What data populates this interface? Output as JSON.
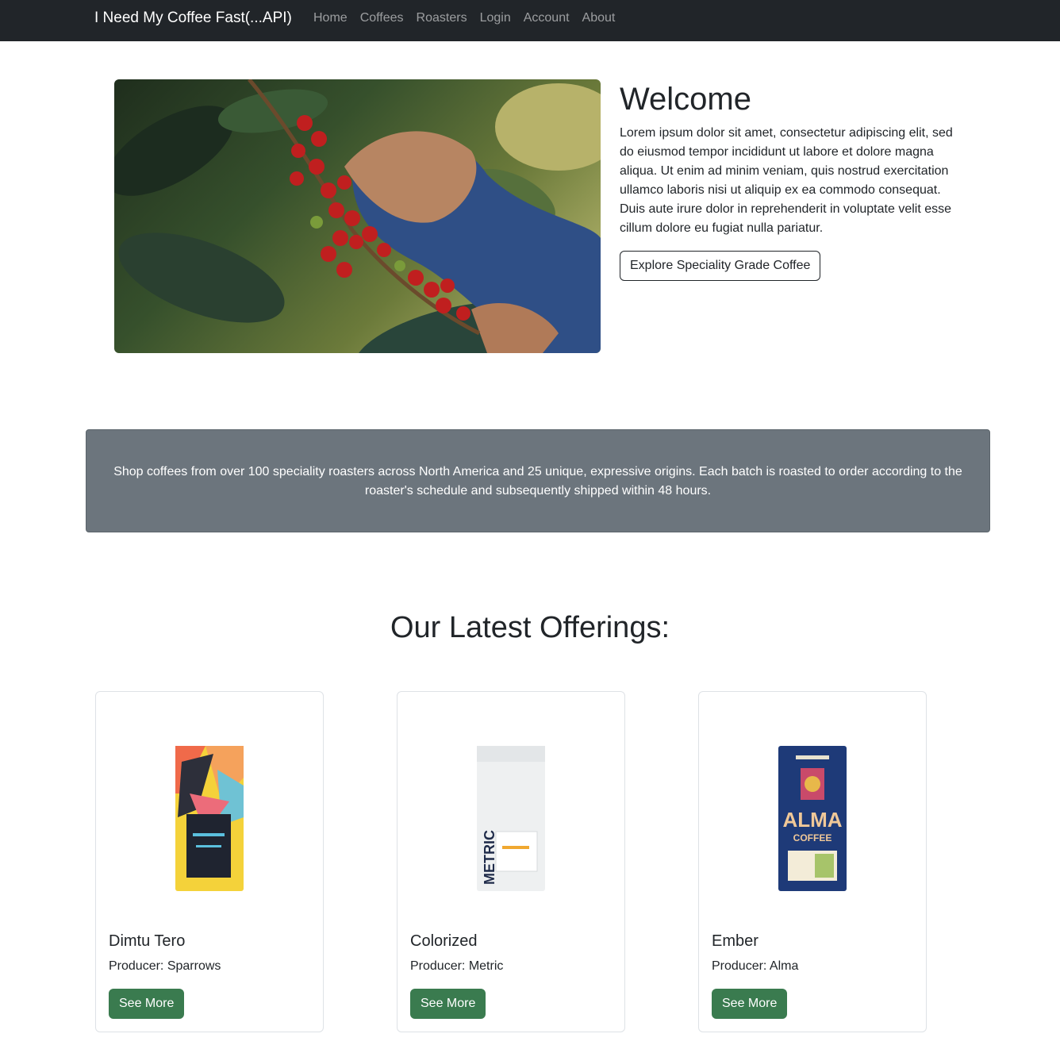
{
  "navbar": {
    "brand": "I Need My Coffee Fast(...API)",
    "links": [
      "Home",
      "Coffees",
      "Roasters",
      "Login",
      "Account",
      "About"
    ]
  },
  "hero": {
    "title": "Welcome",
    "text": "Lorem ipsum dolor sit amet, consectetur adipiscing elit, sed do eiusmod tempor incididunt ut labore et dolore magna aliqua. Ut enim ad minim veniam, quis nostrud exercitation ullamco laboris nisi ut aliquip ex ea commodo consequat. Duis aute irure dolor in reprehenderit in voluptate velit esse cillum dolore eu fugiat nulla pariatur.",
    "button_label": "Explore Speciality Grade Coffee"
  },
  "banner": {
    "text": "Shop coffees from over 100 speciality roasters across North America and 25 unique, expressive origins. Each batch is roasted to order according to the roaster's schedule and subsequently shipped within 48 hours."
  },
  "offerings": {
    "title": "Our Latest Offerings:",
    "cards": [
      {
        "name": "Dimtu Tero",
        "producer": "Producer: Sparrows",
        "button": "See More"
      },
      {
        "name": "Colorized",
        "producer": "Producer: Metric",
        "button": "See More"
      },
      {
        "name": "Ember",
        "producer": "Producer: Alma",
        "button": "See More"
      }
    ]
  },
  "colors": {
    "navbar": "#212529",
    "banner": "#6c757d",
    "success": "#3a7b4f"
  }
}
